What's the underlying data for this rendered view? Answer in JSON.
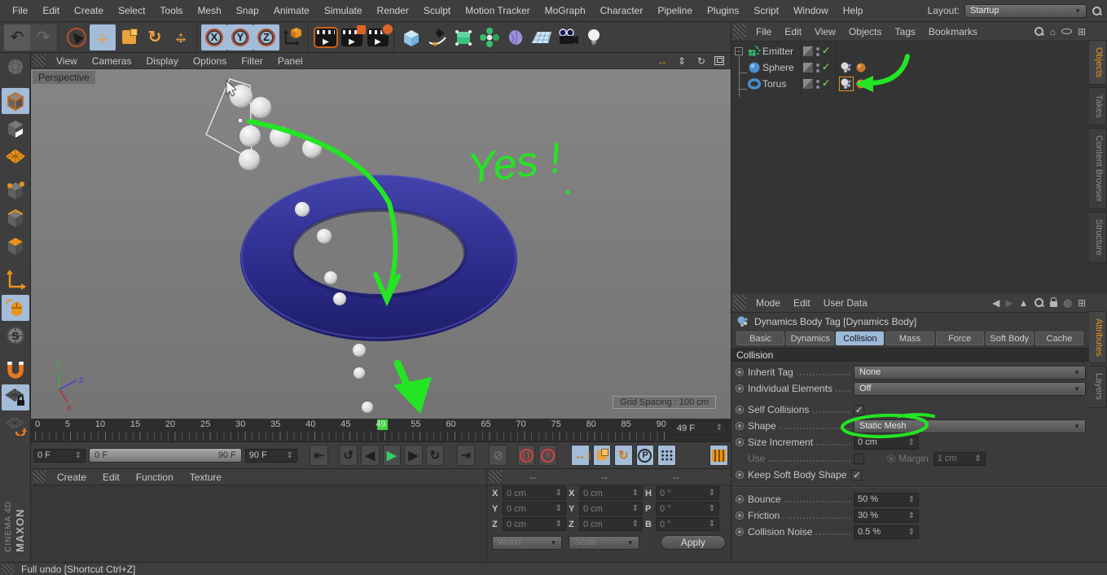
{
  "colors": {
    "accent_orange": "#e8941a",
    "highlight_blue": "#a3bcd9",
    "annotation_green": "#23e523",
    "torus_blue": "#2d2d8c",
    "check_green": "#76c044",
    "viewport_gray": "#7c7c7c"
  },
  "icons": {
    "undo": "↶",
    "redo": "↷",
    "chev": "▼",
    "step": "⇕",
    "prev": "◀",
    "next": "▶",
    "play": "▶",
    "back_loop": "↺",
    "fwd_loop": "↻",
    "goto_start": "⇤",
    "goto_end": "⇥",
    "record_off": "⊘",
    "autokey": "( )",
    "question": "?",
    "home": "⌂",
    "plus": "⊞",
    "back": "◀",
    "fwd": "▶",
    "up": "▲",
    "target": "◎",
    "check": "✓",
    "minus": "−",
    "h_arrow": "↔",
    "v_arrow": "↕",
    "dolly": "⇕",
    "rotate_view": "↻",
    "letter_p": "P",
    "letter_s": "S"
  },
  "menubar": {
    "items": [
      "File",
      "Edit",
      "Create",
      "Select",
      "Tools",
      "Mesh",
      "Snap",
      "Animate",
      "Simulate",
      "Render",
      "Sculpt",
      "Motion Tracker",
      "MoGraph",
      "Character",
      "Pipeline",
      "Plugins",
      "Script",
      "Window",
      "Help"
    ],
    "layout_label": "Layout:",
    "layout_value": "Startup"
  },
  "toolbar": {
    "axis": [
      "X",
      "Y",
      "Z"
    ]
  },
  "viewport": {
    "menu": [
      "View",
      "Cameras",
      "Display",
      "Options",
      "Filter",
      "Panel"
    ],
    "camera_label": "Perspective",
    "grid_spacing": "Grid Spacing : 100 cm",
    "annotation": "Yes !",
    "axis_labels": {
      "x": "X",
      "y": "Y",
      "z": "Z"
    }
  },
  "timeline": {
    "ticks": [
      "0",
      "5",
      "10",
      "15",
      "20",
      "25",
      "30",
      "35",
      "40",
      "45",
      "49",
      "55",
      "60",
      "65",
      "70",
      "75",
      "80",
      "85",
      "90"
    ],
    "current_frame": "49 F"
  },
  "transport": {
    "start_frame": "0 F",
    "range_start": "0 F",
    "range_end": "90 F",
    "end_frame": "90 F"
  },
  "materials": {
    "menu": [
      "Create",
      "Edit",
      "Function",
      "Texture"
    ]
  },
  "coordinates": {
    "headers": [
      "--",
      "--",
      "--"
    ],
    "labels": [
      "X",
      "Y",
      "Z",
      "X",
      "Y",
      "Z",
      "H",
      "P",
      "B"
    ],
    "values": [
      "0 cm",
      "0 cm",
      "0 cm",
      "0 cm",
      "0 cm",
      "0 cm",
      "0 °",
      "0 °",
      "0 °"
    ],
    "space": "World",
    "mode": "Scale",
    "apply": "Apply"
  },
  "object_manager": {
    "menu": [
      "File",
      "Edit",
      "View",
      "Objects",
      "Tags",
      "Bookmarks"
    ],
    "side_tabs": [
      "Objects",
      "Takes",
      "Content Browser",
      "Structure"
    ],
    "objects": [
      {
        "name": "Emitter"
      },
      {
        "name": "Sphere"
      },
      {
        "name": "Torus"
      }
    ]
  },
  "attributes": {
    "menu": [
      "Mode",
      "Edit",
      "User Data"
    ],
    "side_tabs": [
      "Attributes",
      "Layers"
    ],
    "title": "Dynamics Body Tag [Dynamics Body]",
    "tabs": [
      "Basic",
      "Dynamics",
      "Collision",
      "Mass",
      "Force",
      "Soft Body",
      "Cache"
    ],
    "active_tab": "Collision",
    "section": "Collision",
    "rows": [
      {
        "label": "Inherit Tag",
        "value": "None"
      },
      {
        "label": "Individual Elements",
        "value": "Off"
      },
      {
        "label": "Self Collisions",
        "checked": true
      },
      {
        "label": "Shape",
        "value": "Static Mesh"
      },
      {
        "label": "Size Increment",
        "value": "0 cm"
      },
      {
        "label": "Use",
        "margin_label": "Margin",
        "margin_value": "1 cm"
      },
      {
        "label": "Keep Soft Body Shape",
        "checked": true
      },
      {
        "label": "Bounce",
        "value": "50 %"
      },
      {
        "label": "Friction",
        "value": "30 %"
      },
      {
        "label": "Collision Noise",
        "value": "0.5 %"
      }
    ]
  },
  "status_bar": {
    "text": "Full undo [Shortcut Ctrl+Z]"
  },
  "branding": {
    "maxon": "MAXON",
    "cinema": "CINEMA 4D"
  }
}
